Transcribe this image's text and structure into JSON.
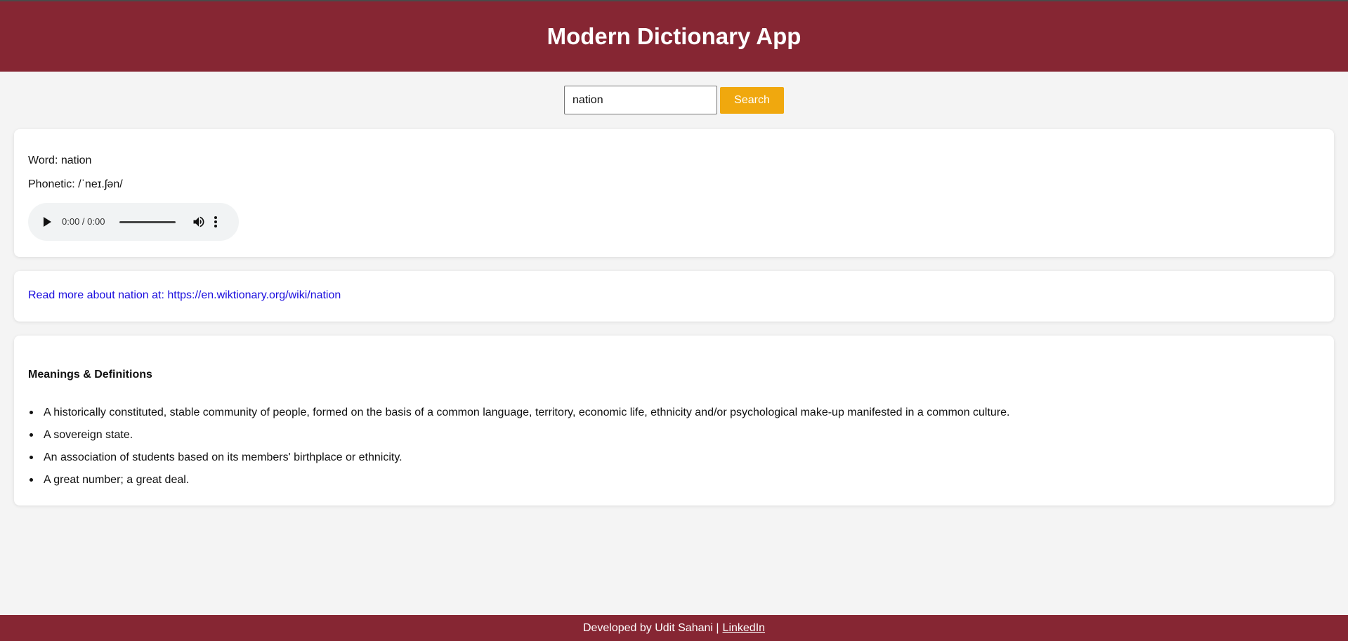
{
  "header": {
    "title": "Modern Dictionary App"
  },
  "search": {
    "value": "nation",
    "button_label": "Search"
  },
  "word_card": {
    "word_line": "Word: nation",
    "phonetic_line": "Phonetic: /ˈneɪ.ʃən/",
    "audio": {
      "time": "0:00 / 0:00"
    }
  },
  "link_card": {
    "text": "Read more about nation at: https://en.wiktionary.org/wiki/nation"
  },
  "meanings_card": {
    "heading": "Meanings & Definitions",
    "definitions": [
      "A historically constituted, stable community of people, formed on the basis of a common language, territory, economic life, ethnicity and/or psychological make-up manifested in a common culture.",
      "A sovereign state.",
      "An association of students based on its members' birthplace or ethnicity.",
      "A great number; a great deal."
    ]
  },
  "footer": {
    "text": "Developed by Udit Sahani |",
    "link_label": "LinkedIn"
  },
  "colors": {
    "brand": "#862633",
    "accent": "#f0a80e",
    "link": "#1a0dde",
    "background": "#f4f4f4"
  },
  "icons": {
    "play": "play-icon",
    "volume": "volume-icon",
    "more": "more-options-icon"
  }
}
